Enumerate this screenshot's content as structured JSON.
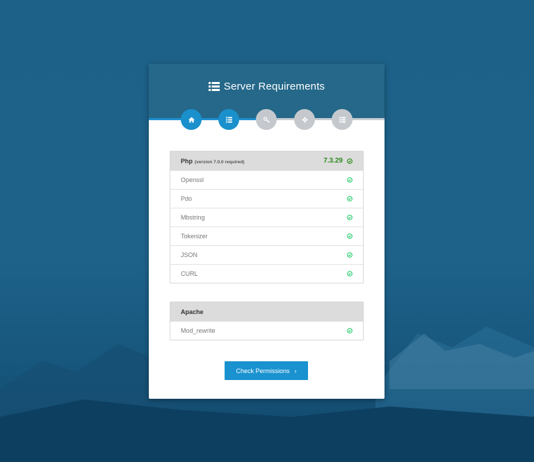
{
  "title": "Server Requirements",
  "icons": {
    "title": "list-icon",
    "steps": [
      "home-icon",
      "list-icon",
      "key-icon",
      "gear-icon",
      "list-icon"
    ],
    "check": "check-circle-icon",
    "chevron": "chevron-right-icon"
  },
  "steps_state": [
    "active",
    "active",
    "inactive",
    "inactive",
    "inactive"
  ],
  "php": {
    "label": "Php",
    "note": "(version 7.0.0 required)",
    "version": "7.3.29",
    "extensions": [
      "Openssl",
      "Pdo",
      "Mbstring",
      "Tokenizer",
      "JSON",
      "CURL"
    ]
  },
  "apache": {
    "label": "Apache",
    "modules": [
      "Mod_rewrite"
    ]
  },
  "button": {
    "label": "Check Permissions",
    "chevron": "›"
  },
  "colors": {
    "accent": "#1a92d0",
    "header": "#256889",
    "success": "#2ecc71",
    "version_text": "#2e8b1f"
  }
}
